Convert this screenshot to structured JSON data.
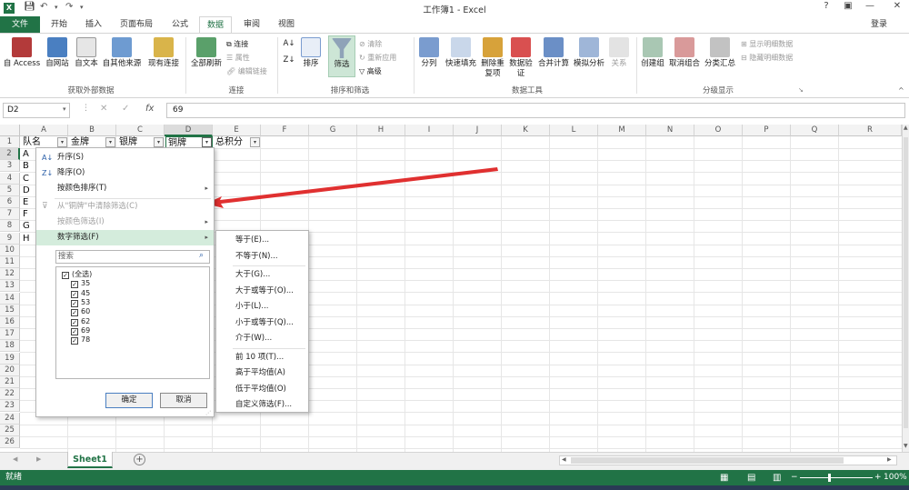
{
  "window": {
    "title": "工作簿1 - Excel",
    "signin": "登录",
    "help": "?",
    "minimize": "—",
    "restore": "❐",
    "close": "✕"
  },
  "tabs": [
    {
      "label": "文件"
    },
    {
      "label": "开始"
    },
    {
      "label": "插入"
    },
    {
      "label": "页面布局"
    },
    {
      "label": "公式"
    },
    {
      "label": "数据"
    },
    {
      "label": "审阅"
    },
    {
      "label": "视图"
    }
  ],
  "ribbon": {
    "get_external": {
      "group": "获取外部数据",
      "buttons": [
        "自 Access",
        "自网站",
        "自文本",
        "自其他来源",
        "现有连接"
      ]
    },
    "connections": {
      "group": "连接",
      "refresh": "全部刷新",
      "small": [
        "连接",
        "属性",
        "编辑链接"
      ]
    },
    "sort_filter": {
      "group": "排序和筛选",
      "sort": "排序",
      "filter": "筛选",
      "small": [
        "清除",
        "重新应用",
        "高级"
      ]
    },
    "data_tools": {
      "group": "数据工具",
      "buttons": [
        "分列",
        "快速填充",
        "删除重复项",
        "数据验证",
        "合并计算",
        "模拟分析",
        "关系"
      ]
    },
    "outline": {
      "group": "分级显示",
      "buttons": [
        "创建组",
        "取消组合",
        "分类汇总"
      ],
      "small": [
        "显示明细数据",
        "隐藏明细数据"
      ]
    }
  },
  "formula_bar": {
    "name_box": "D2",
    "fx": "fx",
    "value": "69"
  },
  "columns": [
    "A",
    "B",
    "C",
    "D",
    "E",
    "F",
    "G",
    "H",
    "I",
    "J",
    "K",
    "L",
    "M",
    "N",
    "O",
    "P",
    "Q",
    "R"
  ],
  "rows": [
    "1",
    "2",
    "3",
    "4",
    "5",
    "6",
    "7",
    "8",
    "9",
    "10",
    "11",
    "12",
    "13",
    "14",
    "15",
    "16",
    "17",
    "18",
    "19",
    "20",
    "21",
    "22",
    "23",
    "24",
    "25",
    "26"
  ],
  "headers": [
    "队名",
    "金牌",
    "银牌",
    "铜牌",
    "总积分"
  ],
  "team_names": [
    "A",
    "B",
    "C",
    "D",
    "E",
    "F",
    "G",
    "H"
  ],
  "filter_menu": {
    "items": [
      {
        "label": "升序(S)",
        "disabled": false
      },
      {
        "label": "降序(O)",
        "disabled": false
      },
      {
        "label": "按颜色排序(T)",
        "disabled": false
      },
      {
        "label": "从\"铜牌\"中清除筛选(C)",
        "disabled": true
      },
      {
        "label": "按颜色筛选(I)",
        "disabled": true
      },
      {
        "label": "数字筛选(F)",
        "disabled": false
      }
    ],
    "search_placeholder": "搜索",
    "checklist": [
      "(全选)",
      "35",
      "45",
      "53",
      "60",
      "62",
      "69",
      "78"
    ],
    "ok": "确定",
    "cancel": "取消"
  },
  "number_filters": [
    "等于(E)...",
    "不等于(N)...",
    "大于(G)...",
    "大于或等于(O)...",
    "小于(L)...",
    "小于或等于(Q)...",
    "介于(W)...",
    "前 10 项(T)...",
    "高于平均值(A)",
    "低于平均值(O)",
    "自定义筛选(F)..."
  ],
  "sheets": [
    "Sheet1"
  ],
  "status": {
    "ready": "就绪",
    "zoom": "100%"
  },
  "colors": {
    "excel_green": "#217346",
    "menu_highlight": "#d4ecdc",
    "arrow_red": "#e03030"
  }
}
